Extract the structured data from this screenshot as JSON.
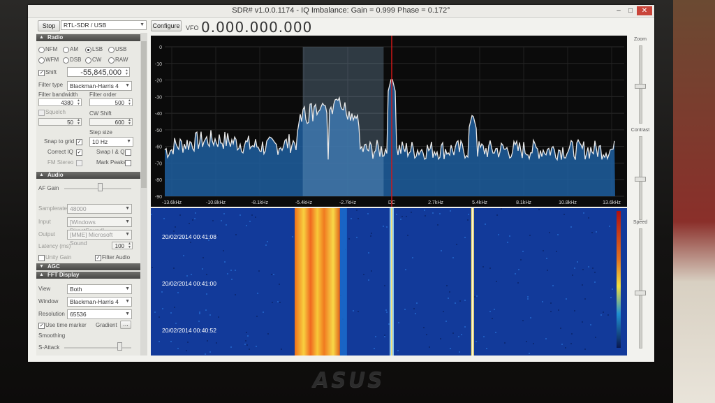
{
  "window": {
    "title": "SDR# v1.0.0.1174 - IQ Imbalance: Gain = 0.999 Phase = 0.172°",
    "minimize": "–",
    "maximize": "□",
    "close": "✕"
  },
  "toolbar": {
    "stop_label": "Stop",
    "device": "RTL-SDR / USB",
    "configure_label": "Configure",
    "vfo_label": "VFO",
    "vfo_value": "0.000.000.000"
  },
  "radio": {
    "header": "Radio",
    "modes": [
      "NFM",
      "AM",
      "LSB",
      "USB",
      "WFM",
      "DSB",
      "CW",
      "RAW"
    ],
    "selected_mode": "LSB",
    "shift_label": "Shift",
    "shift_checked": true,
    "shift_value": "-55,845,000",
    "filter_type_label": "Filter type",
    "filter_type_value": "Blackman-Harris 4",
    "filter_bandwidth_label": "Filter bandwidth",
    "filter_bandwidth_value": "4380",
    "filter_order_label": "Filter order",
    "filter_order_value": "500",
    "squelch_label": "Squelch",
    "squelch_value": "50",
    "cw_shift_label": "CW Shift",
    "cw_shift_value": "600",
    "step_size_label": "Step size",
    "snap_label": "Snap to grid",
    "step_value": "10 Hz",
    "correct_iq_label": "Correct IQ",
    "swap_iq_label": "Swap I & Q",
    "fm_stereo_label": "FM Stereo",
    "mark_peaks_label": "Mark Peaks"
  },
  "audio": {
    "header": "Audio",
    "af_gain_label": "AF Gain",
    "samplerate_label": "Samplerate",
    "samplerate_value": "48000",
    "input_label": "Input",
    "input_value": "[Windows DirectSound]",
    "output_label": "Output",
    "output_value": "[MME] Microsoft Sound",
    "latency_label": "Latency (ms)",
    "latency_value": "100",
    "unity_gain_label": "Unity Gain",
    "filter_audio_label": "Filter Audio"
  },
  "agc": {
    "header": "AGC"
  },
  "fft_display": {
    "header": "FFT Display",
    "view_label": "View",
    "view_value": "Both",
    "window_label": "Window",
    "window_value": "Blackman-Harris 4",
    "resolution_label": "Resolution",
    "resolution_value": "65536",
    "time_marker_label": "Use time marker",
    "gradient_label": "Gradient",
    "gradient_button": "...",
    "smoothing_label": "Smoothing",
    "s_attack_label": "S-Attack"
  },
  "right_bar": {
    "zoom_label": "Zoom",
    "contrast_label": "Contrast",
    "speed_label": "Speed"
  },
  "spectrum": {
    "y_ticks": [
      "0",
      "-10",
      "-20",
      "-30",
      "-40",
      "-50",
      "-60",
      "-70",
      "-80",
      "-90"
    ],
    "x_ticks": [
      "-13.6kHz",
      "-10.8kHz",
      "-8.1kHz",
      "-5.4kHz",
      "-2.7kHz",
      "DC",
      "2.7kHz",
      "5.4kHz",
      "8.1kHz",
      "10.8kHz",
      "13.6kHz"
    ],
    "peak_positions_khz": [
      -5.0,
      -3.6,
      0.0,
      5.0
    ],
    "trace_color": "#e8e8e8",
    "fill_color": "#1e5fa0",
    "passband_color": "#8fb8d8",
    "center_line_color": "#d01818"
  },
  "waterfall": {
    "timestamps": [
      "20/02/2014 00:41:08",
      "20/02/2014 00:41:00",
      "20/02/2014 00:40:52"
    ]
  },
  "monitor": {
    "brand": "ASUS"
  }
}
